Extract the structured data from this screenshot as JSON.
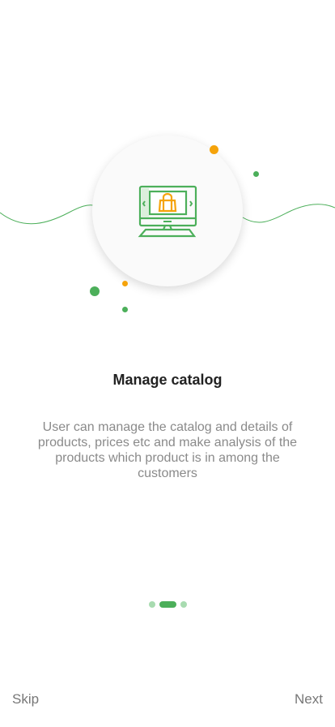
{
  "illustration": {
    "icon": "monitor-shopping-bag-icon",
    "accent_green": "#4caf5a",
    "accent_orange": "#f5a30a"
  },
  "title": "Manage catalog",
  "description": "User can manage the catalog and details of products, prices etc and make analysis of the products which product is in among the customers",
  "pager": {
    "count": 3,
    "active": 1
  },
  "skip_label": "Skip",
  "next_label": "Next"
}
